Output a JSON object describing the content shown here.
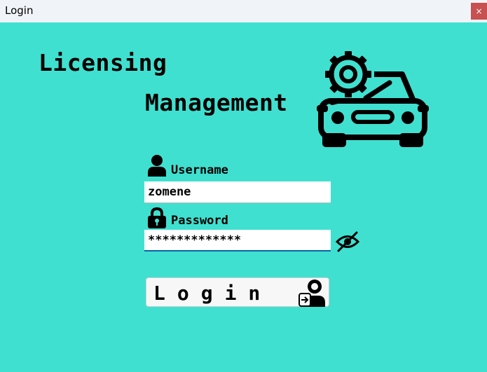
{
  "window": {
    "title": "Login",
    "close_label": "×"
  },
  "header": {
    "line1": "Licensing",
    "line2": "Management"
  },
  "form": {
    "username_label": "Username",
    "username_value": "zomene",
    "password_label": "Password",
    "password_value": "*************",
    "login_label": "Login"
  },
  "colors": {
    "background": "#40E0D0",
    "focus_underline": "#0A64A4",
    "close_button": "#C75050"
  },
  "icons": [
    "car-gear-icon",
    "user-icon",
    "lock-icon",
    "eye-slash-icon",
    "login-user-icon"
  ]
}
